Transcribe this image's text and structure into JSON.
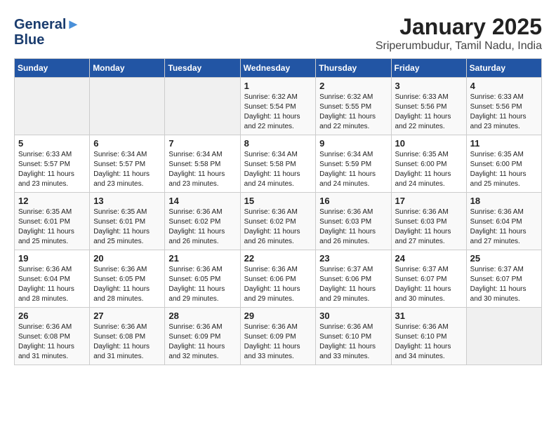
{
  "header": {
    "month_year": "January 2025",
    "location": "Sriperumbudur, Tamil Nadu, India",
    "logo_line1": "General",
    "logo_line2": "Blue"
  },
  "days_of_week": [
    "Sunday",
    "Monday",
    "Tuesday",
    "Wednesday",
    "Thursday",
    "Friday",
    "Saturday"
  ],
  "weeks": [
    [
      {
        "day": "",
        "info": ""
      },
      {
        "day": "",
        "info": ""
      },
      {
        "day": "",
        "info": ""
      },
      {
        "day": "1",
        "info": "Sunrise: 6:32 AM\nSunset: 5:54 PM\nDaylight: 11 hours and 22 minutes."
      },
      {
        "day": "2",
        "info": "Sunrise: 6:32 AM\nSunset: 5:55 PM\nDaylight: 11 hours and 22 minutes."
      },
      {
        "day": "3",
        "info": "Sunrise: 6:33 AM\nSunset: 5:56 PM\nDaylight: 11 hours and 22 minutes."
      },
      {
        "day": "4",
        "info": "Sunrise: 6:33 AM\nSunset: 5:56 PM\nDaylight: 11 hours and 23 minutes."
      }
    ],
    [
      {
        "day": "5",
        "info": "Sunrise: 6:33 AM\nSunset: 5:57 PM\nDaylight: 11 hours and 23 minutes."
      },
      {
        "day": "6",
        "info": "Sunrise: 6:34 AM\nSunset: 5:57 PM\nDaylight: 11 hours and 23 minutes."
      },
      {
        "day": "7",
        "info": "Sunrise: 6:34 AM\nSunset: 5:58 PM\nDaylight: 11 hours and 23 minutes."
      },
      {
        "day": "8",
        "info": "Sunrise: 6:34 AM\nSunset: 5:58 PM\nDaylight: 11 hours and 24 minutes."
      },
      {
        "day": "9",
        "info": "Sunrise: 6:34 AM\nSunset: 5:59 PM\nDaylight: 11 hours and 24 minutes."
      },
      {
        "day": "10",
        "info": "Sunrise: 6:35 AM\nSunset: 6:00 PM\nDaylight: 11 hours and 24 minutes."
      },
      {
        "day": "11",
        "info": "Sunrise: 6:35 AM\nSunset: 6:00 PM\nDaylight: 11 hours and 25 minutes."
      }
    ],
    [
      {
        "day": "12",
        "info": "Sunrise: 6:35 AM\nSunset: 6:01 PM\nDaylight: 11 hours and 25 minutes."
      },
      {
        "day": "13",
        "info": "Sunrise: 6:35 AM\nSunset: 6:01 PM\nDaylight: 11 hours and 25 minutes."
      },
      {
        "day": "14",
        "info": "Sunrise: 6:36 AM\nSunset: 6:02 PM\nDaylight: 11 hours and 26 minutes."
      },
      {
        "day": "15",
        "info": "Sunrise: 6:36 AM\nSunset: 6:02 PM\nDaylight: 11 hours and 26 minutes."
      },
      {
        "day": "16",
        "info": "Sunrise: 6:36 AM\nSunset: 6:03 PM\nDaylight: 11 hours and 26 minutes."
      },
      {
        "day": "17",
        "info": "Sunrise: 6:36 AM\nSunset: 6:03 PM\nDaylight: 11 hours and 27 minutes."
      },
      {
        "day": "18",
        "info": "Sunrise: 6:36 AM\nSunset: 6:04 PM\nDaylight: 11 hours and 27 minutes."
      }
    ],
    [
      {
        "day": "19",
        "info": "Sunrise: 6:36 AM\nSunset: 6:04 PM\nDaylight: 11 hours and 28 minutes."
      },
      {
        "day": "20",
        "info": "Sunrise: 6:36 AM\nSunset: 6:05 PM\nDaylight: 11 hours and 28 minutes."
      },
      {
        "day": "21",
        "info": "Sunrise: 6:36 AM\nSunset: 6:05 PM\nDaylight: 11 hours and 29 minutes."
      },
      {
        "day": "22",
        "info": "Sunrise: 6:36 AM\nSunset: 6:06 PM\nDaylight: 11 hours and 29 minutes."
      },
      {
        "day": "23",
        "info": "Sunrise: 6:37 AM\nSunset: 6:06 PM\nDaylight: 11 hours and 29 minutes."
      },
      {
        "day": "24",
        "info": "Sunrise: 6:37 AM\nSunset: 6:07 PM\nDaylight: 11 hours and 30 minutes."
      },
      {
        "day": "25",
        "info": "Sunrise: 6:37 AM\nSunset: 6:07 PM\nDaylight: 11 hours and 30 minutes."
      }
    ],
    [
      {
        "day": "26",
        "info": "Sunrise: 6:36 AM\nSunset: 6:08 PM\nDaylight: 11 hours and 31 minutes."
      },
      {
        "day": "27",
        "info": "Sunrise: 6:36 AM\nSunset: 6:08 PM\nDaylight: 11 hours and 31 minutes."
      },
      {
        "day": "28",
        "info": "Sunrise: 6:36 AM\nSunset: 6:09 PM\nDaylight: 11 hours and 32 minutes."
      },
      {
        "day": "29",
        "info": "Sunrise: 6:36 AM\nSunset: 6:09 PM\nDaylight: 11 hours and 33 minutes."
      },
      {
        "day": "30",
        "info": "Sunrise: 6:36 AM\nSunset: 6:10 PM\nDaylight: 11 hours and 33 minutes."
      },
      {
        "day": "31",
        "info": "Sunrise: 6:36 AM\nSunset: 6:10 PM\nDaylight: 11 hours and 34 minutes."
      },
      {
        "day": "",
        "info": ""
      }
    ]
  ]
}
